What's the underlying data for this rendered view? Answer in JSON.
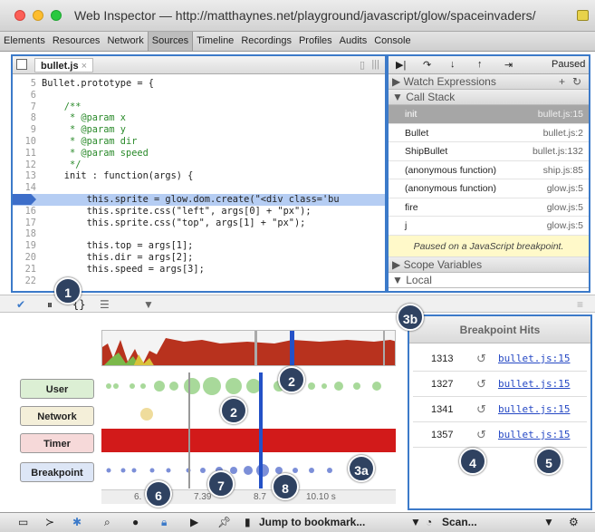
{
  "window": {
    "title": "Web Inspector — http://matthaynes.net/playground/javascript/glow/spaceinvaders/"
  },
  "tabs": [
    "Elements",
    "Resources",
    "Network",
    "Sources",
    "Timeline",
    "Recordings",
    "Profiles",
    "Audits",
    "Console"
  ],
  "selected_tab": "Sources",
  "editor": {
    "file_tab": "bullet.js",
    "lines": [
      {
        "n": "5",
        "code": "Bullet.prototype = {",
        "c": ""
      },
      {
        "n": "6",
        "code": "",
        "c": ""
      },
      {
        "n": "7",
        "code": "    /**",
        "c": "cm"
      },
      {
        "n": "8",
        "code": "     * @param x",
        "c": "cm"
      },
      {
        "n": "9",
        "code": "     * @param y",
        "c": "cm"
      },
      {
        "n": "10",
        "code": "     * @param dir",
        "c": "cm"
      },
      {
        "n": "11",
        "code": "     * @param speed",
        "c": "cm"
      },
      {
        "n": "12",
        "code": "     */",
        "c": "cm"
      },
      {
        "n": "13",
        "code": "    init : function(args) {",
        "c": ""
      },
      {
        "n": "14",
        "code": "",
        "c": ""
      },
      {
        "n": "15",
        "code": "        this.sprite = glow.dom.create(\"<div class='bu",
        "c": "hl"
      },
      {
        "n": "16",
        "code": "        this.sprite.css(\"left\", args[0] + \"px\");",
        "c": ""
      },
      {
        "n": "17",
        "code": "        this.sprite.css(\"top\", args[1] + \"px\");",
        "c": ""
      },
      {
        "n": "18",
        "code": "",
        "c": ""
      },
      {
        "n": "19",
        "code": "        this.top = args[1];",
        "c": ""
      },
      {
        "n": "20",
        "code": "        this.dir = args[2];",
        "c": ""
      },
      {
        "n": "21",
        "code": "        this.speed = args[3];",
        "c": ""
      },
      {
        "n": "22",
        "code": "",
        "c": ""
      }
    ]
  },
  "debugger": {
    "paused_label": "Paused",
    "watch_label": "Watch Expressions",
    "callstack_label": "Call Stack",
    "frames": [
      {
        "name": "init",
        "loc": "bullet.js:15"
      },
      {
        "name": "Bullet",
        "loc": "bullet.js:2"
      },
      {
        "name": "ShipBullet",
        "loc": "bullet.js:132"
      },
      {
        "name": "(anonymous function)",
        "loc": "ship.js:85"
      },
      {
        "name": "(anonymous function)",
        "loc": "glow.js:5"
      },
      {
        "name": "fire",
        "loc": "glow.js:5"
      },
      {
        "name": "j",
        "loc": "glow.js:5"
      }
    ],
    "paused_message": "Paused on a JavaScript breakpoint.",
    "scope_label": "Scope Variables",
    "local_label": "Local"
  },
  "timeline": {
    "rows": [
      {
        "label": "User",
        "bg": "#dcefd4"
      },
      {
        "label": "Network",
        "bg": "#f4efd9"
      },
      {
        "label": "Timer",
        "bg": "#f6d9d9"
      },
      {
        "label": "Breakpoint",
        "bg": "#dde6f6"
      }
    ],
    "ticks": [
      "6.",
      "7.39",
      "8.7",
      "10.10 s"
    ]
  },
  "breakpoint_hits": {
    "title": "Breakpoint Hits",
    "rows": [
      {
        "time": "1313",
        "link": "bullet.js:15"
      },
      {
        "time": "1327",
        "link": "bullet.js:15"
      },
      {
        "time": "1341",
        "link": "bullet.js:15"
      },
      {
        "time": "1357",
        "link": "bullet.js:15"
      }
    ]
  },
  "statusbar": {
    "bookmark": "Jump to bookmark...",
    "scan": "Scan..."
  },
  "callouts": [
    "1",
    "2",
    "2",
    "3a",
    "3b",
    "4",
    "5",
    "6",
    "7",
    "8"
  ],
  "colors": {
    "accent": "#3c7ac9",
    "callout": "#2f4261",
    "timer": "#d21a1a",
    "user": "#a8d99a",
    "breakpoint": "#7c8fd8"
  }
}
